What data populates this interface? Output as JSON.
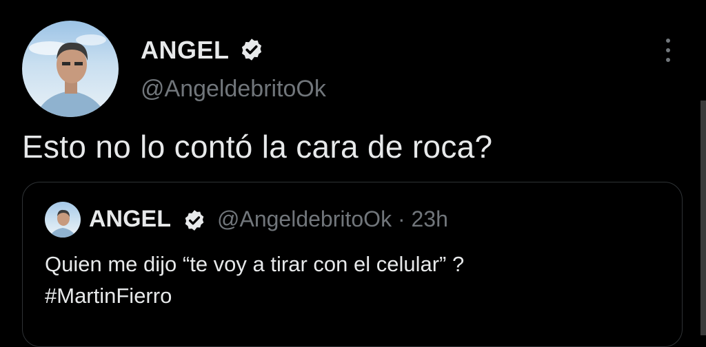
{
  "tweet": {
    "author_name": "ANGEL",
    "author_handle": "@AngeldebritoOk",
    "text": "Esto no lo contó la cara de roca?",
    "icons": {
      "verified": "verified-badge-icon",
      "more": "more-options-icon"
    },
    "colors": {
      "background": "#000000",
      "text": "#e7e9ea",
      "muted": "#71767b",
      "border": "#2f3336"
    }
  },
  "quoted": {
    "author_name": "ANGEL",
    "author_handle": "@AngeldebritoOk",
    "separator": "·",
    "time": "23h",
    "line1": "Quien me dijo “te voy a tirar con el celular” ?",
    "line2": "#MartinFierro"
  }
}
